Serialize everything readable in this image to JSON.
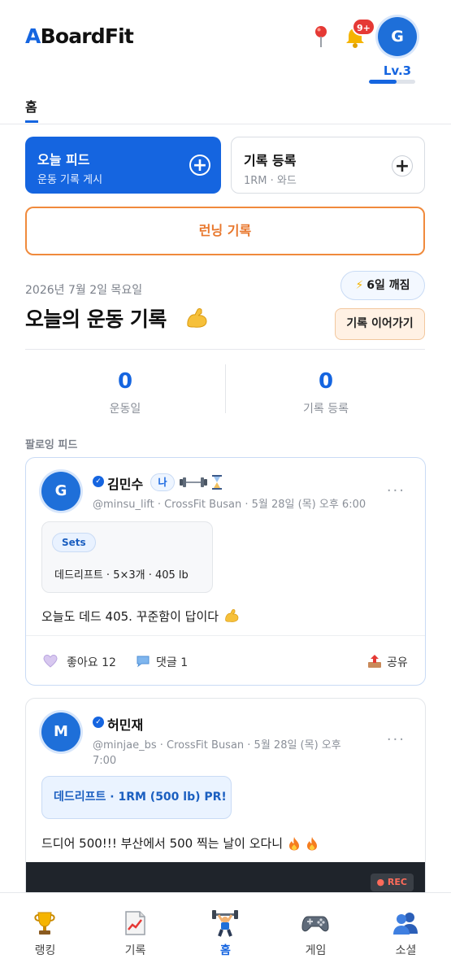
{
  "header": {
    "logo_a": "A",
    "logo_rest": "BoardFit",
    "notif_badge": "9+",
    "avatar_initial": "G",
    "level": "Lv.3",
    "level_progress": 0.6
  },
  "tabs": {
    "home": "홈"
  },
  "quick": {
    "feed_title": "오늘 피드",
    "feed_sub": "운동 기록 게시",
    "record_title": "기록 등록",
    "record_sub": "1RM · 와드",
    "plus": "+"
  },
  "run_button": "런닝 기록",
  "today": {
    "date": "2026년 7월 2일 목요일",
    "streak": "6일 깨짐",
    "title": "오늘의 운동 기록",
    "continue": "기록 이어가기",
    "stats": [
      {
        "value": "0",
        "label": "운동일"
      },
      {
        "value": "0",
        "label": "기록 등록"
      }
    ]
  },
  "feed_label": "팔로잉 피드",
  "posts": [
    {
      "avatar": "G",
      "name": "김민수",
      "me_badge": "나",
      "meta": "@minsu_lift · CrossFit Busan · 5월 28일 (목) 오후 6:00",
      "more": "···",
      "sets_pill": "Sets",
      "sets_text": "데드리프트 · 5×3개 · 405 lb",
      "body": "오늘도 데드 405. 꾸준함이 답이다",
      "like": "좋아요 12",
      "comment": "댓글 1",
      "share": "공유"
    },
    {
      "avatar": "M",
      "name": "허민재",
      "meta_line1": "@minjae_bs · CrossFit Busan · 5월 28일 (목) 오후",
      "meta_line2": "7:00",
      "more": "···",
      "pr_text": "데드리프트 · 1RM (500 lb)  PR!",
      "body": "드디어 500!!! 부산에서 500 찍는 날이 오다니",
      "rec": "● REC"
    }
  ],
  "bottom_nav": [
    {
      "label": "랭킹",
      "icon": "trophy-icon"
    },
    {
      "label": "기록",
      "icon": "chart-icon"
    },
    {
      "label": "홈",
      "icon": "weightlifter-icon",
      "active": true
    },
    {
      "label": "게임",
      "icon": "gamepad-icon"
    },
    {
      "label": "소셜",
      "icon": "people-icon"
    }
  ],
  "colors": {
    "primary": "#1565e0",
    "orange": "#e8772c",
    "badge_red": "#e53935"
  }
}
